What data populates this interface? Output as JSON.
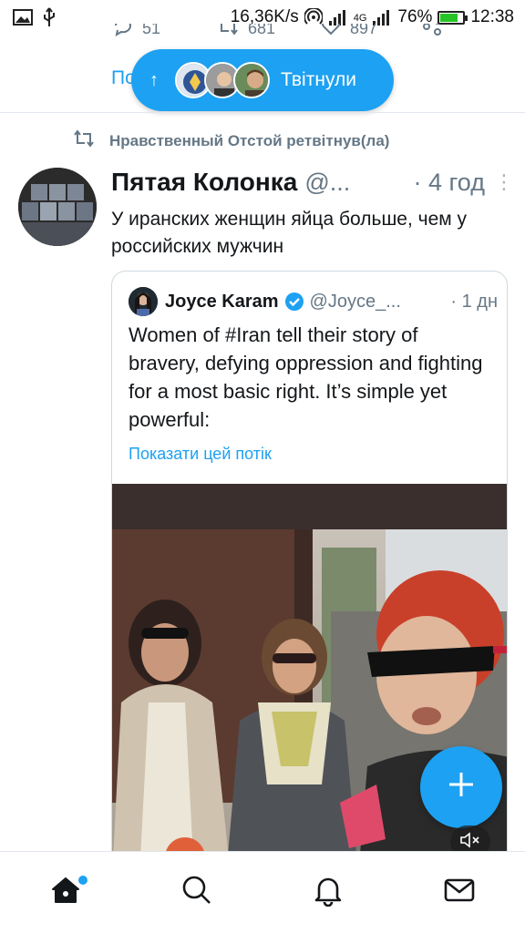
{
  "status_bar": {
    "speed": "16,36K/s",
    "network": "4G",
    "battery": "76%",
    "battery_level": 0.76,
    "time": "12:38"
  },
  "previous_tweet": {
    "reply_count": "51",
    "retweet_count": "681",
    "like_count": "897",
    "link_fragment": "По"
  },
  "retweeted_pill": {
    "label": "Твітнули"
  },
  "tweet": {
    "retweeted_by": "Нравственный Отстой ретвітнув(ла)",
    "author_name": "Пятая Колонка",
    "author_handle": "@...",
    "time": "· 4 год",
    "text": "У иранских женщин яйца больше, чем у российских мужчин"
  },
  "quoted_tweet": {
    "author_name": "Joyce Karam",
    "author_handle": "@Joyce_...",
    "time": "· 1 дн",
    "text": "Women of #Iran tell their story of bravery, defying oppression and fighting for a most basic right. It’s simple yet powerful:",
    "thread_link": "Показати цей потік"
  },
  "colors": {
    "accent": "#1da1f2",
    "secondary_text": "#657786",
    "divider": "#e1e8ed"
  },
  "icons": [
    "image-icon",
    "usb-icon",
    "hotspot-icon",
    "signal-icon",
    "battery-icon",
    "retweet-icon",
    "more-icon",
    "verified-icon",
    "compose-icon",
    "mute-icon",
    "home-icon",
    "search-icon",
    "bell-icon",
    "mail-icon"
  ]
}
